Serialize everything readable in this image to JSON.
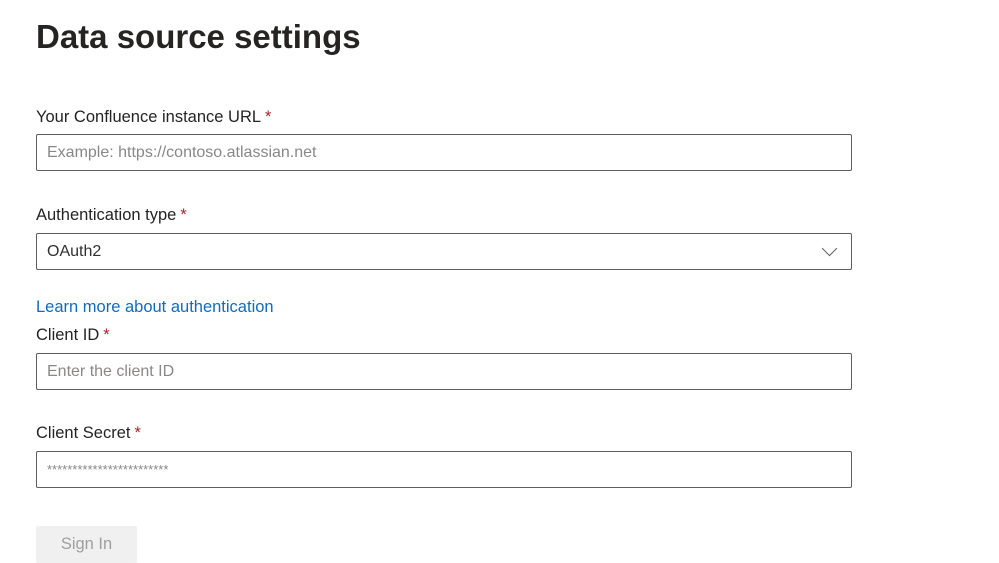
{
  "title": "Data source settings",
  "required_marker": "*",
  "url_field": {
    "label": "Your Confluence instance URL",
    "value": "",
    "placeholder": "Example: https://contoso.atlassian.net"
  },
  "auth_field": {
    "label": "Authentication type",
    "value": "OAuth2"
  },
  "learn_more_link": "Learn more about authentication",
  "client_id_field": {
    "label": "Client ID",
    "value": "",
    "placeholder": "Enter the client ID"
  },
  "client_secret_field": {
    "label": "Client Secret",
    "value": "",
    "placeholder": "************************"
  },
  "sign_in_button": "Sign In"
}
